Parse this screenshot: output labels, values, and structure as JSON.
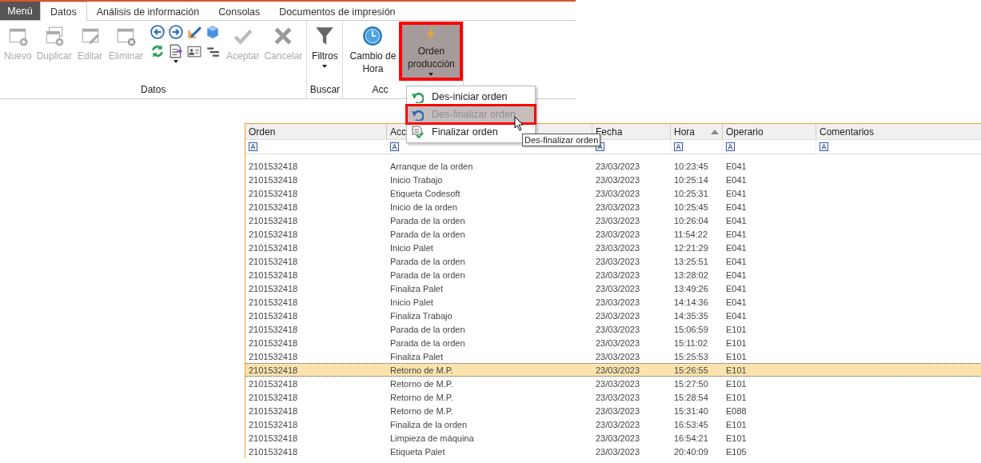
{
  "menu_button": {
    "label": "Menú"
  },
  "tabs": [
    {
      "label": "Datos",
      "selected": true
    },
    {
      "label": "Análisis de información",
      "selected": false
    },
    {
      "label": "Consolas",
      "selected": false
    },
    {
      "label": "Documentos de impresión",
      "selected": false
    }
  ],
  "ribbon_groups": [
    {
      "label": "Datos",
      "items": [
        {
          "kind": "large",
          "label": "Nuevo",
          "disabled": true
        },
        {
          "kind": "large",
          "label": "Duplicar",
          "disabled": true
        },
        {
          "kind": "large",
          "label": "Editar",
          "disabled": true
        },
        {
          "kind": "large",
          "label": "Eliminar",
          "disabled": true
        },
        {
          "kind": "small"
        },
        {
          "kind": "large",
          "label": "Aceptar",
          "disabled": true
        },
        {
          "kind": "large",
          "label": "Cancelar",
          "disabled": true
        }
      ]
    },
    {
      "label": "Buscar",
      "items": [
        {
          "kind": "large",
          "label": "Filtros",
          "disabled": false,
          "dropdown": true
        }
      ]
    },
    {
      "label": "Acc",
      "items": [
        {
          "kind": "large",
          "label": "Cambio de Hora",
          "disabled": false
        },
        {
          "kind": "large",
          "label": "Orden producción",
          "disabled": false,
          "dropdown": true,
          "pressed": true,
          "highlighted": true
        }
      ]
    }
  ],
  "dropdown_menu": [
    {
      "label": "Des-iniciar orden",
      "hovered": false,
      "highlighted": false
    },
    {
      "label": "Des-finalizar orden",
      "hovered": true,
      "highlighted": true
    },
    {
      "label": "Finalizar orden",
      "hovered": false,
      "highlighted": false
    }
  ],
  "tooltip": "Des-finalizar orden",
  "table": {
    "columns": [
      {
        "label": "Orden",
        "sorted": false
      },
      {
        "label": "Acc",
        "sorted": false
      },
      {
        "label": "Fecha",
        "sorted": false
      },
      {
        "label": "Hora",
        "sorted": true
      },
      {
        "label": "Operario",
        "sorted": false
      },
      {
        "label": "Comentarios",
        "sorted": false
      }
    ],
    "rows": [
      {
        "cells": [
          "2101532418",
          "Arranque de la orden",
          "23/03/2023",
          "10:23:45",
          "E041"
        ],
        "selected": false
      },
      {
        "cells": [
          "2101532418",
          "Inicio Trabajo",
          "23/03/2023",
          "10:25:14",
          "E041"
        ],
        "selected": false
      },
      {
        "cells": [
          "2101532418",
          "Etiqueta Codesoft",
          "23/03/2023",
          "10:25:31",
          "E041"
        ],
        "selected": false
      },
      {
        "cells": [
          "2101532418",
          "Inicio de la orden",
          "23/03/2023",
          "10:25:45",
          "E041"
        ],
        "selected": false
      },
      {
        "cells": [
          "2101532418",
          "Parada de la orden",
          "23/03/2023",
          "10:26:04",
          "E041"
        ],
        "selected": false
      },
      {
        "cells": [
          "2101532418",
          "Parada de la orden",
          "23/03/2023",
          "11:54:22",
          "E041"
        ],
        "selected": false
      },
      {
        "cells": [
          "2101532418",
          "Inicio Palet",
          "23/03/2023",
          "12:21:29",
          "E041"
        ],
        "selected": false
      },
      {
        "cells": [
          "2101532418",
          "Parada de la orden",
          "23/03/2023",
          "13:25:51",
          "E041"
        ],
        "selected": false
      },
      {
        "cells": [
          "2101532418",
          "Parada de la orden",
          "23/03/2023",
          "13:28:02",
          "E041"
        ],
        "selected": false
      },
      {
        "cells": [
          "2101532418",
          "Finaliza Palet",
          "23/03/2023",
          "13:49:26",
          "E041"
        ],
        "selected": false
      },
      {
        "cells": [
          "2101532418",
          "Inicio Palet",
          "23/03/2023",
          "14:14:36",
          "E041"
        ],
        "selected": false
      },
      {
        "cells": [
          "2101532418",
          "Finaliza Trabajo",
          "23/03/2023",
          "14:35:35",
          "E041"
        ],
        "selected": false
      },
      {
        "cells": [
          "2101532418",
          "Parada de la orden",
          "23/03/2023",
          "15:06:59",
          "E101"
        ],
        "selected": false
      },
      {
        "cells": [
          "2101532418",
          "Parada de la orden",
          "23/03/2023",
          "15:11:02",
          "E101"
        ],
        "selected": false
      },
      {
        "cells": [
          "2101532418",
          "Finaliza Palet",
          "23/03/2023",
          "15:25:53",
          "E101"
        ],
        "selected": false
      },
      {
        "cells": [
          "2101532418",
          "Retorno de M.P.",
          "23/03/2023",
          "15:26:55",
          "E101"
        ],
        "selected": true
      },
      {
        "cells": [
          "2101532418",
          "Retorno de M.P.",
          "23/03/2023",
          "15:27:50",
          "E101"
        ],
        "selected": false
      },
      {
        "cells": [
          "2101532418",
          "Retorno de M.P.",
          "23/03/2023",
          "15:28:54",
          "E101"
        ],
        "selected": false
      },
      {
        "cells": [
          "2101532418",
          "Retorno de M.P.",
          "23/03/2023",
          "15:31:40",
          "E088"
        ],
        "selected": false
      },
      {
        "cells": [
          "2101532418",
          "Finaliza de la orden",
          "23/03/2023",
          "16:53:45",
          "E101"
        ],
        "selected": false
      },
      {
        "cells": [
          "2101532418",
          "Limpieza de máquina",
          "23/03/2023",
          "16:54:21",
          "E101"
        ],
        "selected": false
      },
      {
        "cells": [
          "2101532418",
          "Etiqueta Palet",
          "23/03/2023",
          "20:40:09",
          "E105"
        ],
        "selected": false
      }
    ]
  }
}
